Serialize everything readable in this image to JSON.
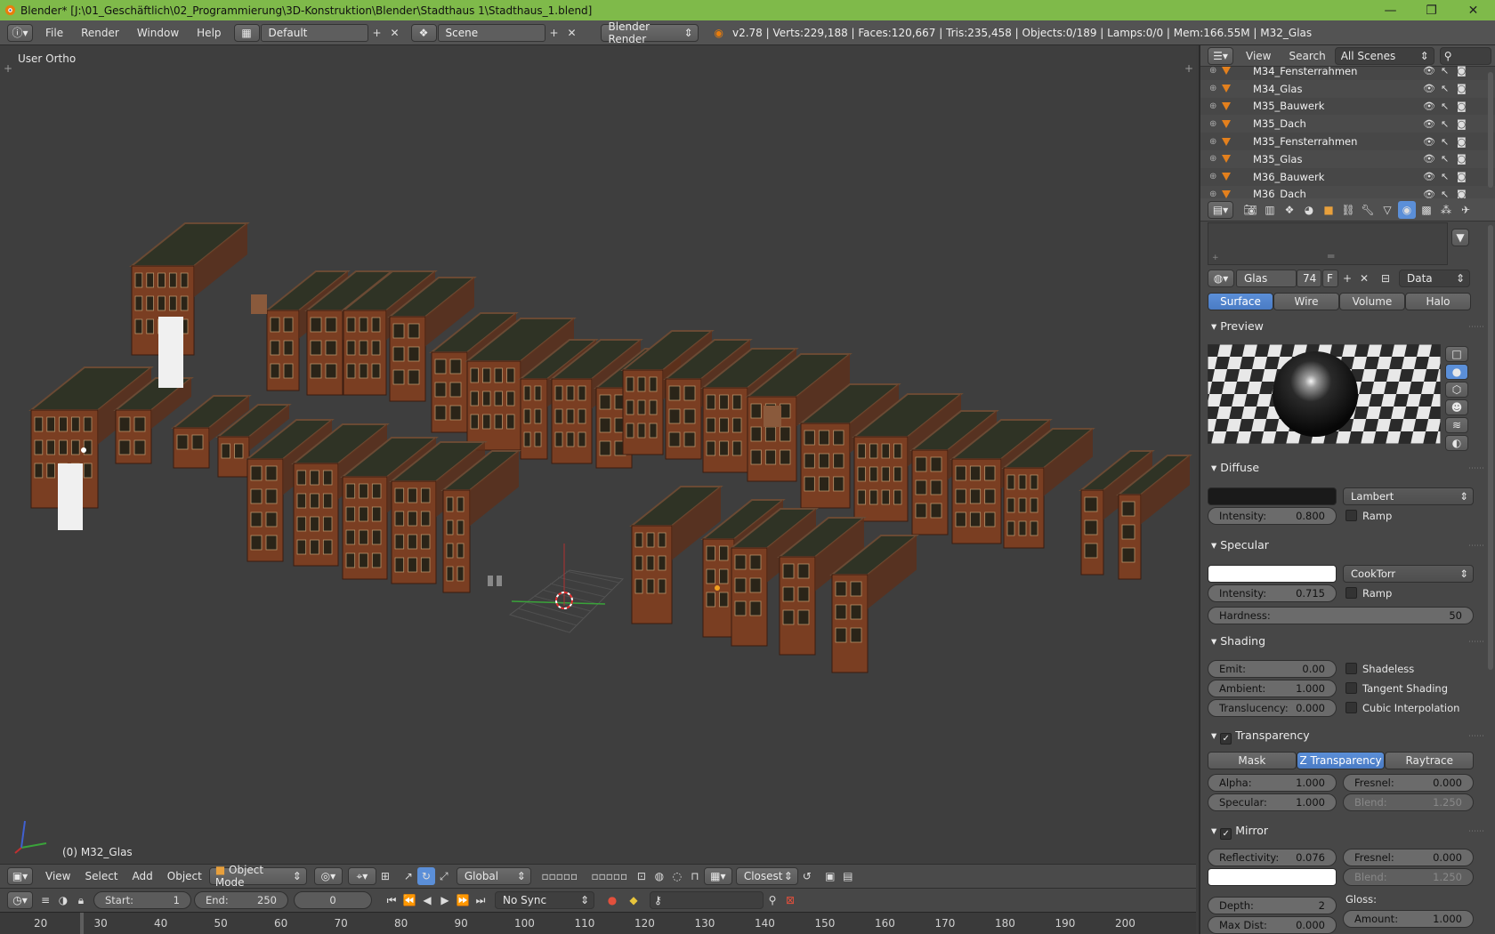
{
  "window": {
    "title": "Blender* [J:\\01_Geschäftlich\\02_Programmierung\\3D-Konstruktion\\Blender\\Stadthaus 1\\Stadthaus_1.blend]",
    "minimize": "—",
    "maximize": "❐",
    "close": "✕"
  },
  "header": {
    "menus": [
      "File",
      "Render",
      "Window",
      "Help"
    ],
    "screen_layout": "Default",
    "scene": "Scene",
    "render_engine": "Blender Render",
    "stats": "v2.78 | Verts:229,188 | Faces:120,667 | Tris:235,458 | Objects:0/189 | Lamps:0/0 | Mem:166.55M | M32_Glas"
  },
  "viewport": {
    "view_label": "User Ortho",
    "object_label": "(0) M32_Glas"
  },
  "view3d_header": {
    "menus": [
      "View",
      "Select",
      "Add",
      "Object"
    ],
    "mode": "Object Mode",
    "orientation": "Global",
    "snap_target": "Closest"
  },
  "timeline": {
    "start_label": "Start:",
    "start": "1",
    "end_label": "End:",
    "end": "250",
    "current": "0",
    "sync": "No Sync",
    "ticks": [
      "20",
      "30",
      "40",
      "50",
      "60",
      "70",
      "80",
      "90",
      "100",
      "110",
      "120",
      "130",
      "140",
      "150",
      "160",
      "170",
      "180",
      "190",
      "200"
    ]
  },
  "outliner": {
    "menus": [
      "View",
      "Search"
    ],
    "filter": "All Scenes",
    "rows": [
      "M34_Fensterrahmen",
      "M34_Glas",
      "M35_Bauwerk",
      "M35_Dach",
      "M35_Fensterrahmen",
      "M35_Glas",
      "M36_Bauwerk",
      "M36_Dach"
    ]
  },
  "properties": {
    "material_name": "Glas",
    "users": "74",
    "fake_user": "F",
    "link": "Data",
    "tabs": [
      "Surface",
      "Wire",
      "Volume",
      "Halo"
    ],
    "preview": {
      "title": "Preview"
    },
    "diffuse": {
      "title": "Diffuse",
      "color": "#1a1a1a",
      "shader": "Lambert",
      "intensity_label": "Intensity:",
      "intensity": "0.800",
      "ramp": "Ramp"
    },
    "specular": {
      "title": "Specular",
      "color": "#ffffff",
      "shader": "CookTorr",
      "intensity_label": "Intensity:",
      "intensity": "0.715",
      "ramp": "Ramp",
      "hardness_label": "Hardness:",
      "hardness": "50"
    },
    "shading": {
      "title": "Shading",
      "emit_label": "Emit:",
      "emit": "0.00",
      "ambient_label": "Ambient:",
      "ambient": "1.000",
      "translucency_label": "Translucency:",
      "translucency": "0.000",
      "shadeless": "Shadeless",
      "tangent": "Tangent Shading",
      "cubic": "Cubic Interpolation"
    },
    "transparency": {
      "title": "Transparency",
      "modes": [
        "Mask",
        "Z Transparency",
        "Raytrace"
      ],
      "alpha_label": "Alpha:",
      "alpha": "1.000",
      "fresnel_label": "Fresnel:",
      "fresnel": "0.000",
      "specular_label": "Specular:",
      "specular": "1.000",
      "blend_label": "Blend:",
      "blend": "1.250"
    },
    "mirror": {
      "title": "Mirror",
      "reflectivity_label": "Reflectivity:",
      "reflectivity": "0.076",
      "fresnel_label": "Fresnel:",
      "fresnel": "0.000",
      "blend_label": "Blend:",
      "blend": "1.250",
      "color": "#ffffff",
      "depth_label": "Depth:",
      "depth": "2",
      "maxdist_label": "Max Dist:",
      "maxdist": "0.000",
      "gloss_label": "Gloss:",
      "amount_label": "Amount:",
      "amount": "1.000"
    }
  },
  "colors": {
    "title_bar": "#7fba4a",
    "accent_selected": "#5b8fd8",
    "brick": "#7a3e22",
    "roof": "#2f3325"
  }
}
